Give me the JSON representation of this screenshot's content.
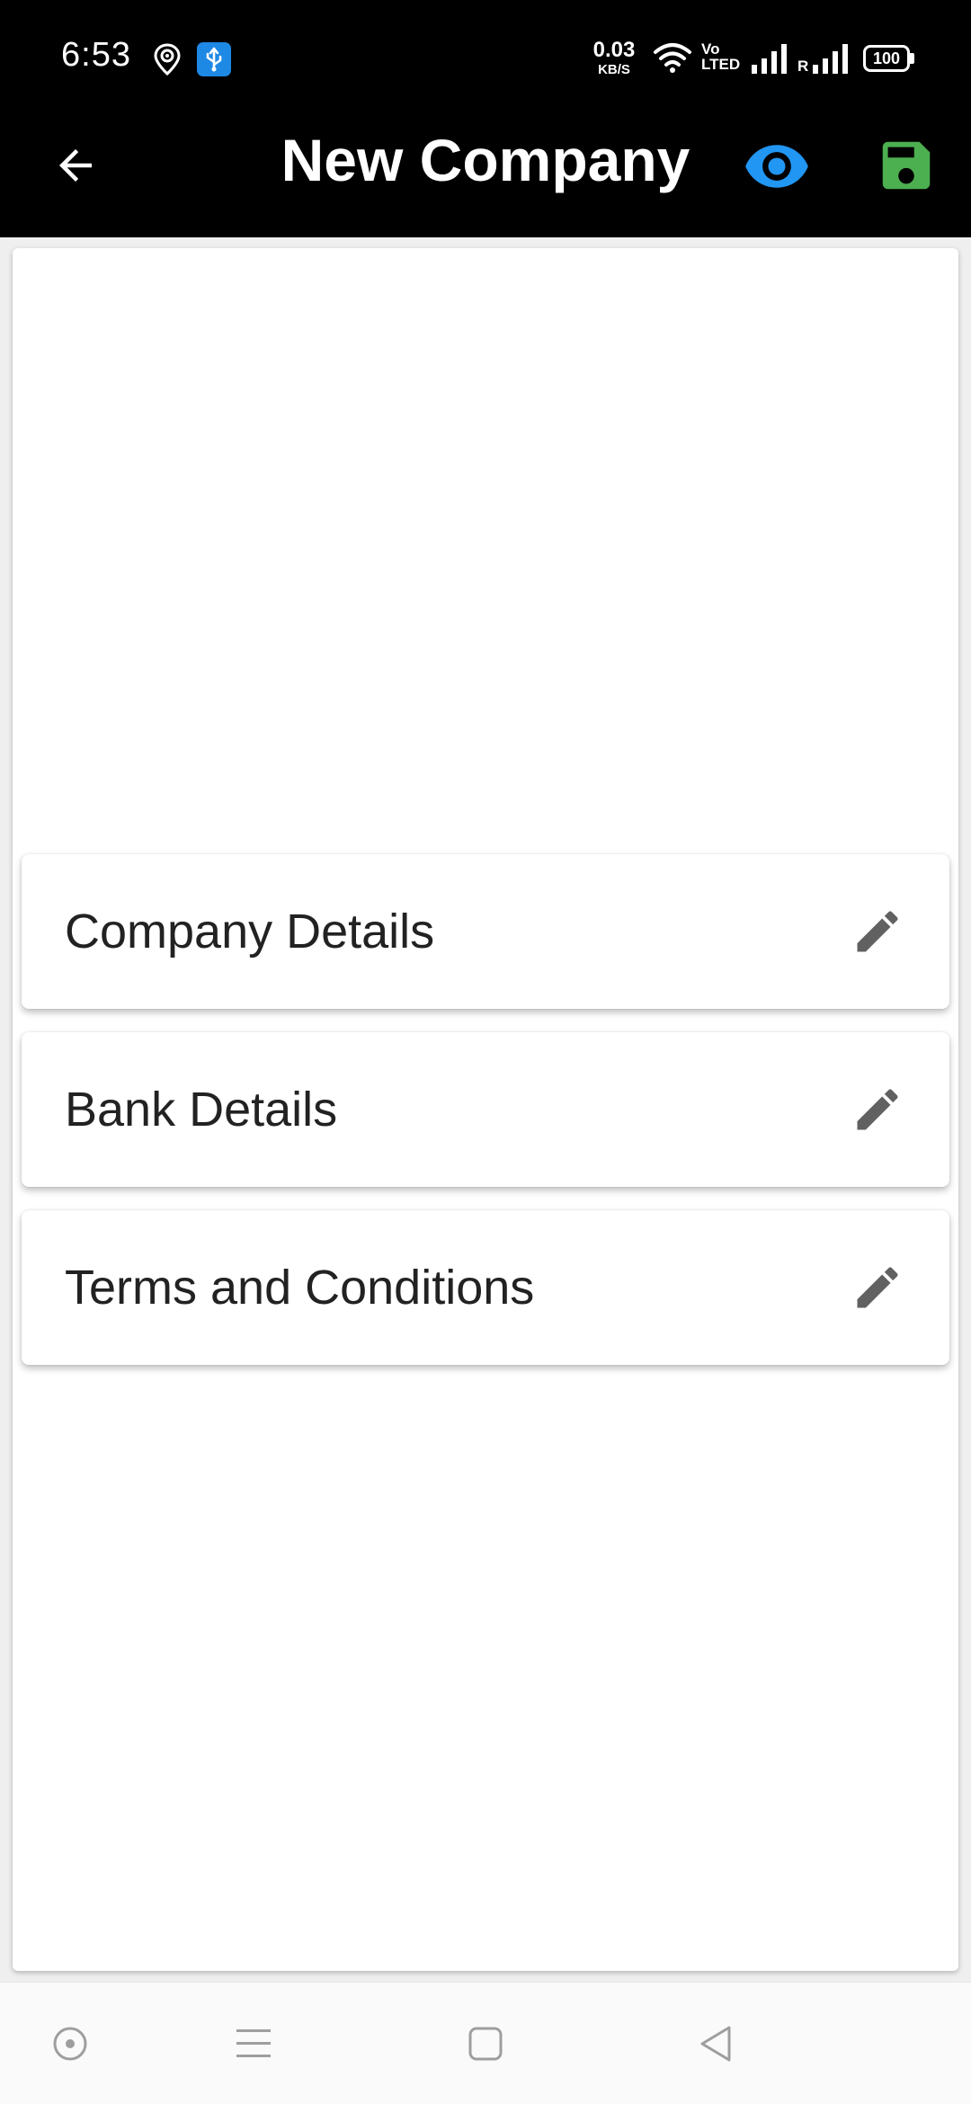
{
  "status_bar": {
    "time": "6:53",
    "net_speed_value": "0.03",
    "net_speed_unit": "KB/S",
    "volte_label_1": "Vo",
    "volte_label_2": "LTED",
    "roaming_label": "R",
    "battery": "100",
    "icons": [
      "location-icon",
      "usb-icon",
      "wifi-icon",
      "signal-icon",
      "signal-roaming-icon",
      "battery-icon"
    ]
  },
  "app_bar": {
    "title": "New Company",
    "back_icon": "arrow-back-icon",
    "preview_icon": "eye-icon",
    "save_icon": "save-icon"
  },
  "colors": {
    "app_bar_bg": "#000000",
    "eye_accent": "#2196F3",
    "save_accent": "#4CAF50",
    "edit_icon": "#616161"
  },
  "sections": [
    {
      "label": "Company Details",
      "icon": "edit-pencil-icon"
    },
    {
      "label": "Bank Details",
      "icon": "edit-pencil-icon"
    },
    {
      "label": "Terms and Conditions",
      "icon": "edit-pencil-icon"
    }
  ],
  "nav_bar": {
    "items": [
      "assistant-icon",
      "recents-menu-icon",
      "home-square-icon",
      "back-triangle-icon"
    ]
  }
}
